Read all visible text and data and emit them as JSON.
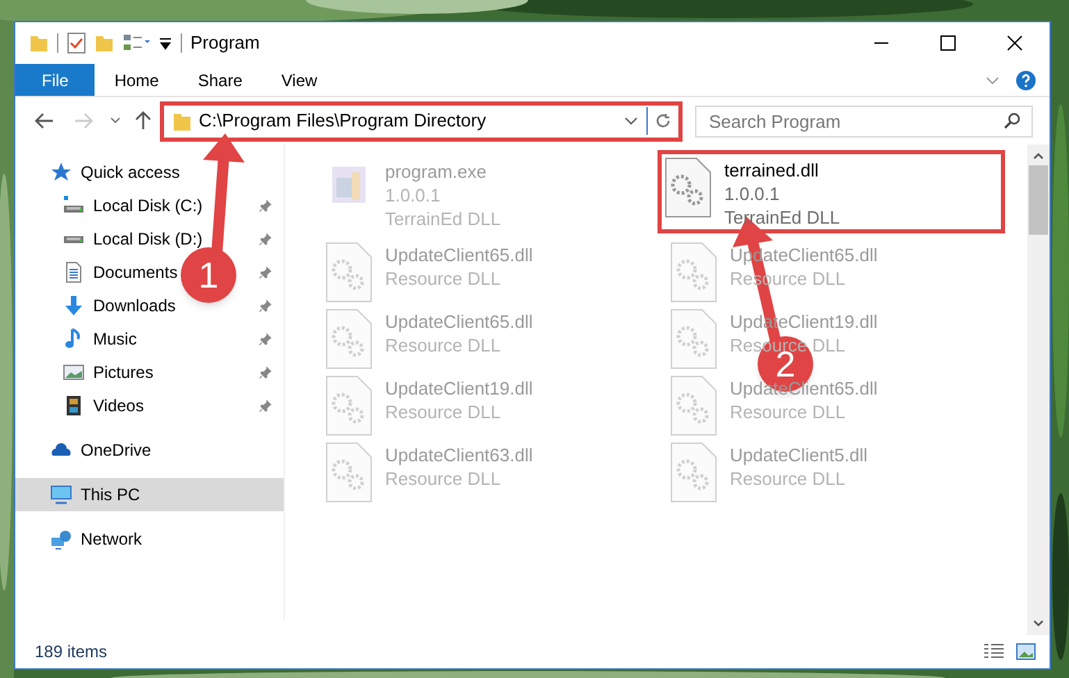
{
  "window": {
    "title": "Program"
  },
  "ribbon_tabs": [
    {
      "label": "File",
      "selected": true
    },
    {
      "label": "Home",
      "selected": false
    },
    {
      "label": "Share",
      "selected": false
    },
    {
      "label": "View",
      "selected": false
    }
  ],
  "address_bar": {
    "path": "C:\\Program Files\\Program Directory",
    "highlighted": true
  },
  "search": {
    "placeholder": "Search Program"
  },
  "sidebar": {
    "items": [
      {
        "label": "Quick access",
        "kind": "star",
        "selected": false,
        "children": [
          {
            "label": "Local Disk (C:)",
            "kind": "drive-c",
            "pinned": true
          },
          {
            "label": "Local Disk (D:)",
            "kind": "drive",
            "pinned": true
          },
          {
            "label": "Documents",
            "kind": "documents",
            "pinned": true
          },
          {
            "label": "Downloads",
            "kind": "downloads",
            "pinned": true
          },
          {
            "label": "Music",
            "kind": "music",
            "pinned": true
          },
          {
            "label": "Pictures",
            "kind": "pictures",
            "pinned": true
          },
          {
            "label": "Videos",
            "kind": "videos",
            "pinned": true
          }
        ]
      },
      {
        "label": "OneDrive",
        "kind": "cloud",
        "selected": false
      },
      {
        "label": "This PC",
        "kind": "pc",
        "selected": true
      },
      {
        "label": "Network",
        "kind": "network",
        "selected": false
      }
    ]
  },
  "files": [
    {
      "kind": "exe",
      "name": "program.exe",
      "lines": [
        "1.0.0.1",
        "TerrainEd DLL"
      ],
      "blurred": true,
      "highlighted": false
    },
    {
      "kind": "dll",
      "name": "terrained.dll",
      "lines": [
        "1.0.0.1",
        "TerrainEd DLL"
      ],
      "blurred": false,
      "highlighted": true
    },
    {
      "kind": "dll",
      "name": "UpdateClient65.dll",
      "lines": [
        "Resource DLL"
      ],
      "blurred": true,
      "highlighted": false
    },
    {
      "kind": "dll",
      "name": "UpdateClient65.dll",
      "lines": [
        "Resource DLL"
      ],
      "blurred": true,
      "highlighted": false
    },
    {
      "kind": "dll",
      "name": "UpdateClient65.dll",
      "lines": [
        "Resource DLL"
      ],
      "blurred": true,
      "highlighted": false
    },
    {
      "kind": "dll",
      "name": "UpdateClient19.dll",
      "lines": [
        "Resource DLL"
      ],
      "blurred": true,
      "highlighted": false
    },
    {
      "kind": "dll",
      "name": "UpdateClient19.dll",
      "lines": [
        "Resource DLL"
      ],
      "blurred": true,
      "highlighted": false
    },
    {
      "kind": "dll",
      "name": "UpdateClient65.dll",
      "lines": [
        "Resource DLL"
      ],
      "blurred": true,
      "highlighted": false
    },
    {
      "kind": "dll",
      "name": "UpdateClient63.dll",
      "lines": [
        "Resource DLL"
      ],
      "blurred": true,
      "highlighted": false
    },
    {
      "kind": "dll",
      "name": "UpdateClient5.dll",
      "lines": [
        "Resource DLL"
      ],
      "blurred": true,
      "highlighted": false
    }
  ],
  "status_bar": {
    "count": "189 items"
  },
  "annotations": [
    {
      "label": "1"
    },
    {
      "label": "2"
    }
  ]
}
